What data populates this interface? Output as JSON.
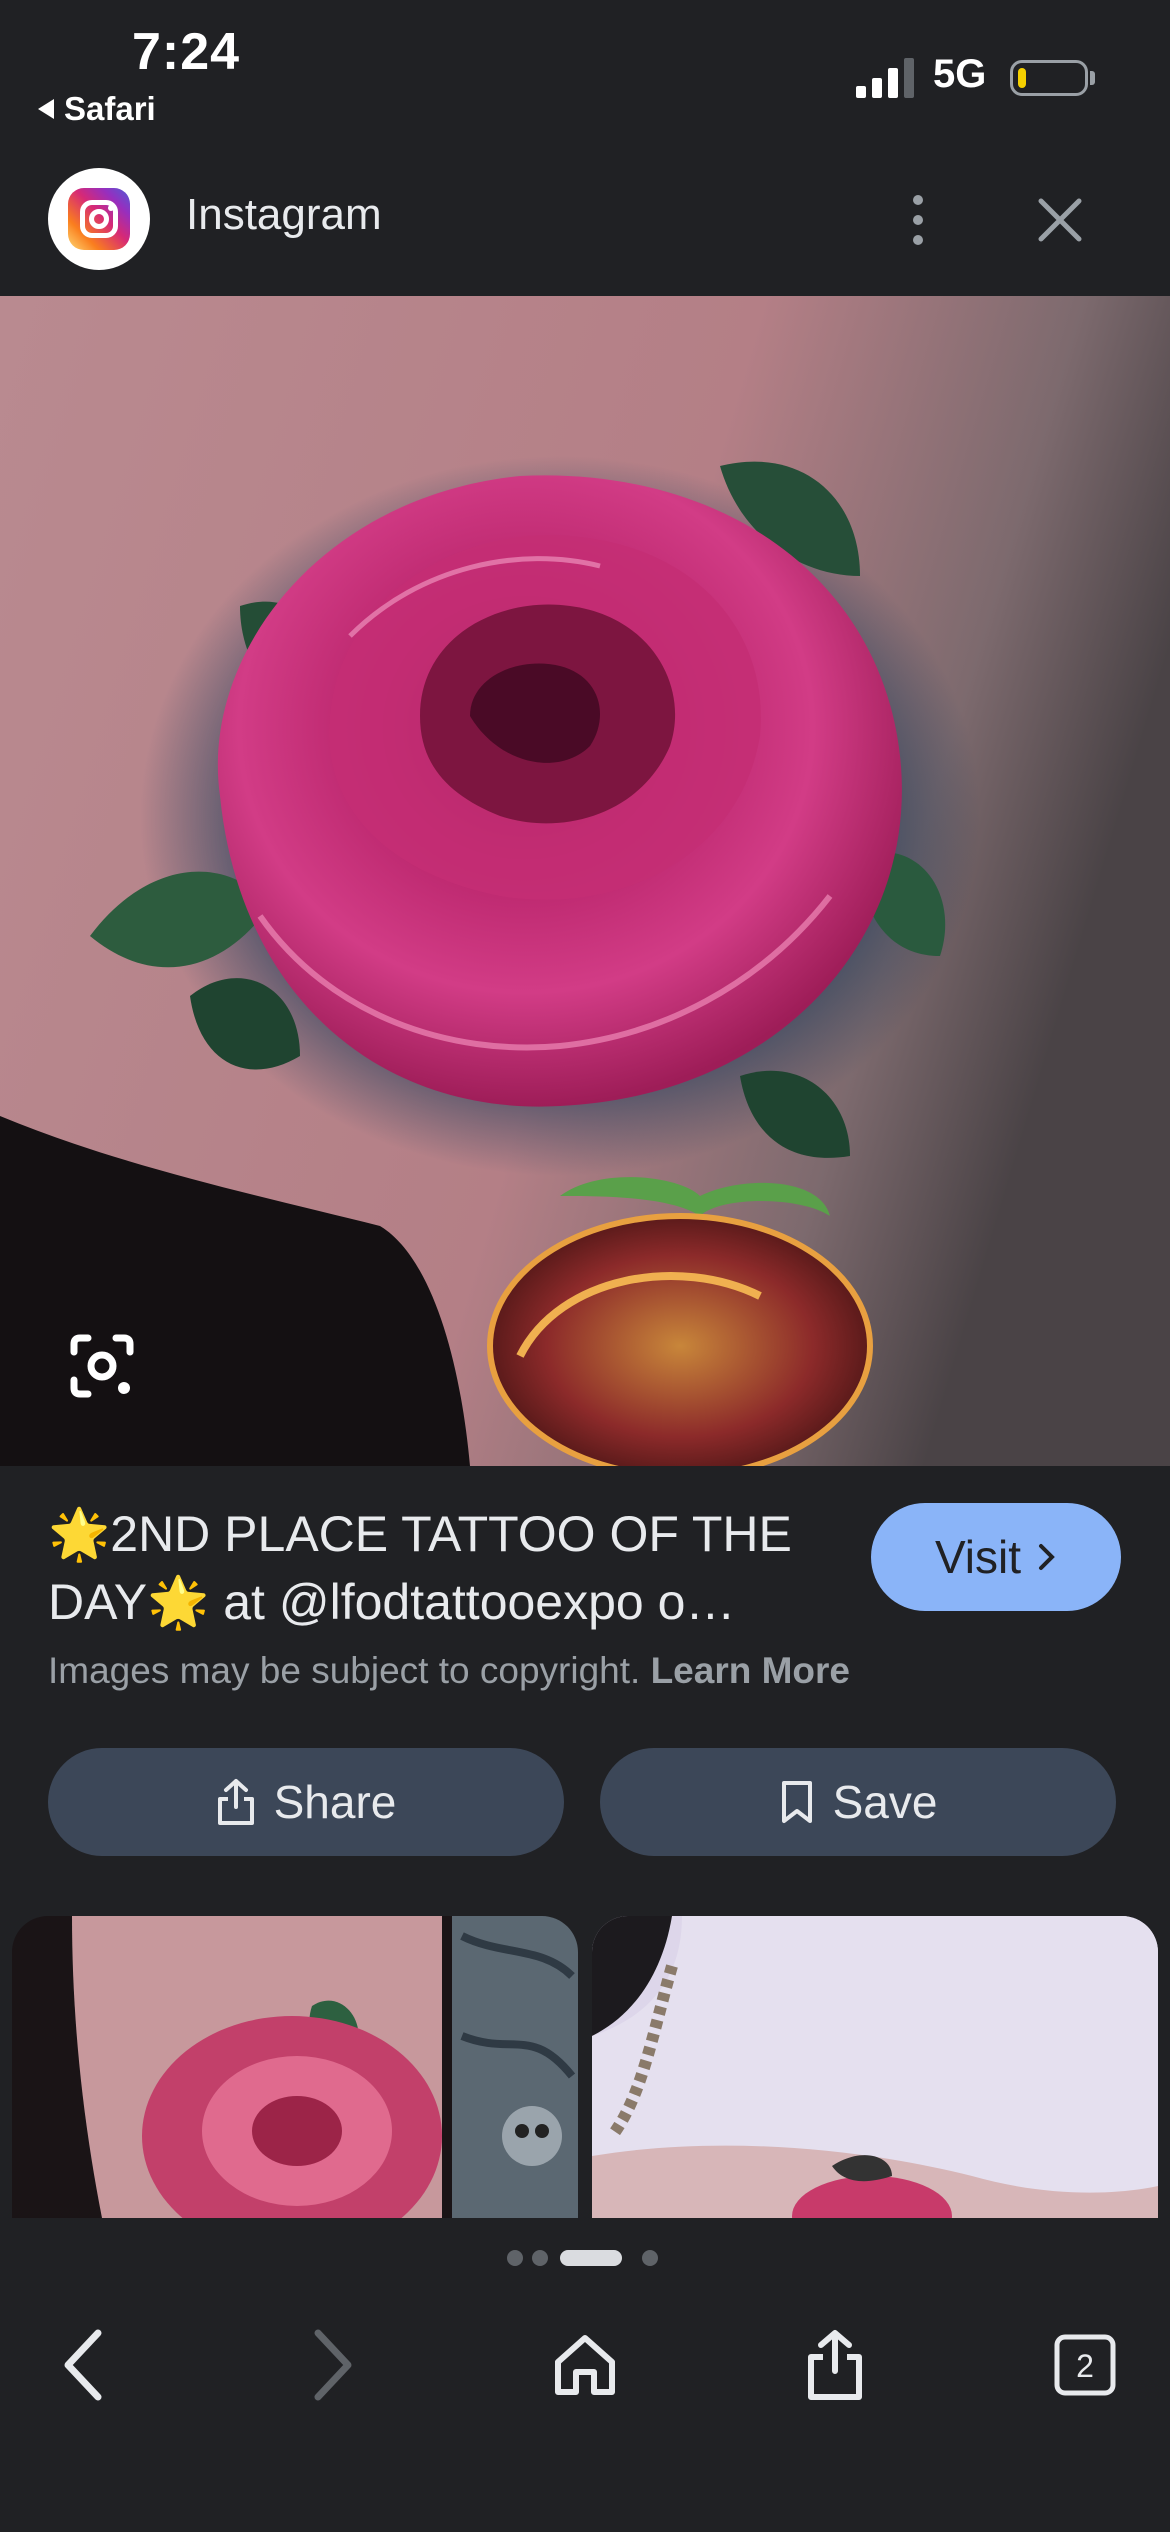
{
  "status_bar": {
    "time": "7:24",
    "back_app": "Safari",
    "network": "5G",
    "battery_level": 0.12,
    "battery_color": "#f5d000"
  },
  "header": {
    "app_name": "Instagram",
    "app_icon": "instagram-logo",
    "more_icon": "more-vert-icon",
    "close_icon": "close-icon"
  },
  "hero": {
    "lens_icon": "google-lens-icon"
  },
  "result": {
    "caption_line1": "🌟2ND PLACE TATTOO OF THE",
    "caption_line2": "DAY🌟 at @lfodtattooexpo o…",
    "visit_label": "Visit",
    "copyright_text": "Images may be subject to copyright.",
    "learn_more": "Learn More"
  },
  "actions": {
    "share_label": "Share",
    "save_label": "Save"
  },
  "pagination": {
    "count": 4,
    "active_index": 2
  },
  "toolbar": {
    "back_icon": "chevron-left-icon",
    "forward_icon": "chevron-right-icon",
    "home_icon": "home-icon",
    "share_icon": "share-icon",
    "tabs_count": "2"
  },
  "colors": {
    "background": "#202124",
    "accent": "#8ab4f8",
    "pill": "#3c4758"
  }
}
